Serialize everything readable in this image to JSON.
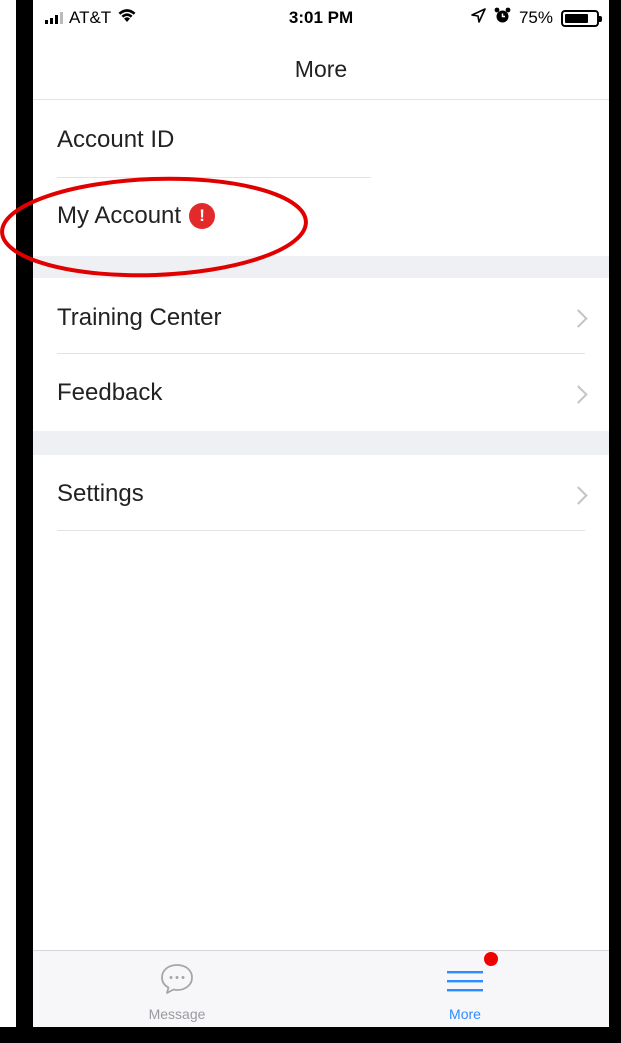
{
  "status_bar": {
    "carrier": "AT&T",
    "time": "3:01 PM",
    "battery_percent": "75%",
    "battery_level": 0.75,
    "icons": [
      "signal-icon",
      "wifi-icon",
      "location-icon",
      "alarm-icon",
      "battery-icon"
    ]
  },
  "nav": {
    "title": "More"
  },
  "sections": [
    {
      "items": [
        {
          "label": "Account ID",
          "chevron": false
        },
        {
          "label": "My Account",
          "chevron": false,
          "alert": "!"
        }
      ]
    },
    {
      "items": [
        {
          "label": "Training Center",
          "chevron": true
        },
        {
          "label": "Feedback",
          "chevron": true
        }
      ]
    },
    {
      "items": [
        {
          "label": "Settings",
          "chevron": true
        }
      ]
    }
  ],
  "tab_bar": {
    "tabs": [
      {
        "label": "Message",
        "icon": "chat-bubble-icon",
        "active": false
      },
      {
        "label": "More",
        "icon": "menu-lines-icon",
        "active": true,
        "has_notification_dot": true
      }
    ]
  },
  "colors": {
    "accent": "#2d8cff",
    "alert": "#e32a2a",
    "notification_dot": "#f00000",
    "annotation": "#e00000",
    "section_gap": "#eff0f4",
    "inactive_tab": "#9a9aa0"
  }
}
